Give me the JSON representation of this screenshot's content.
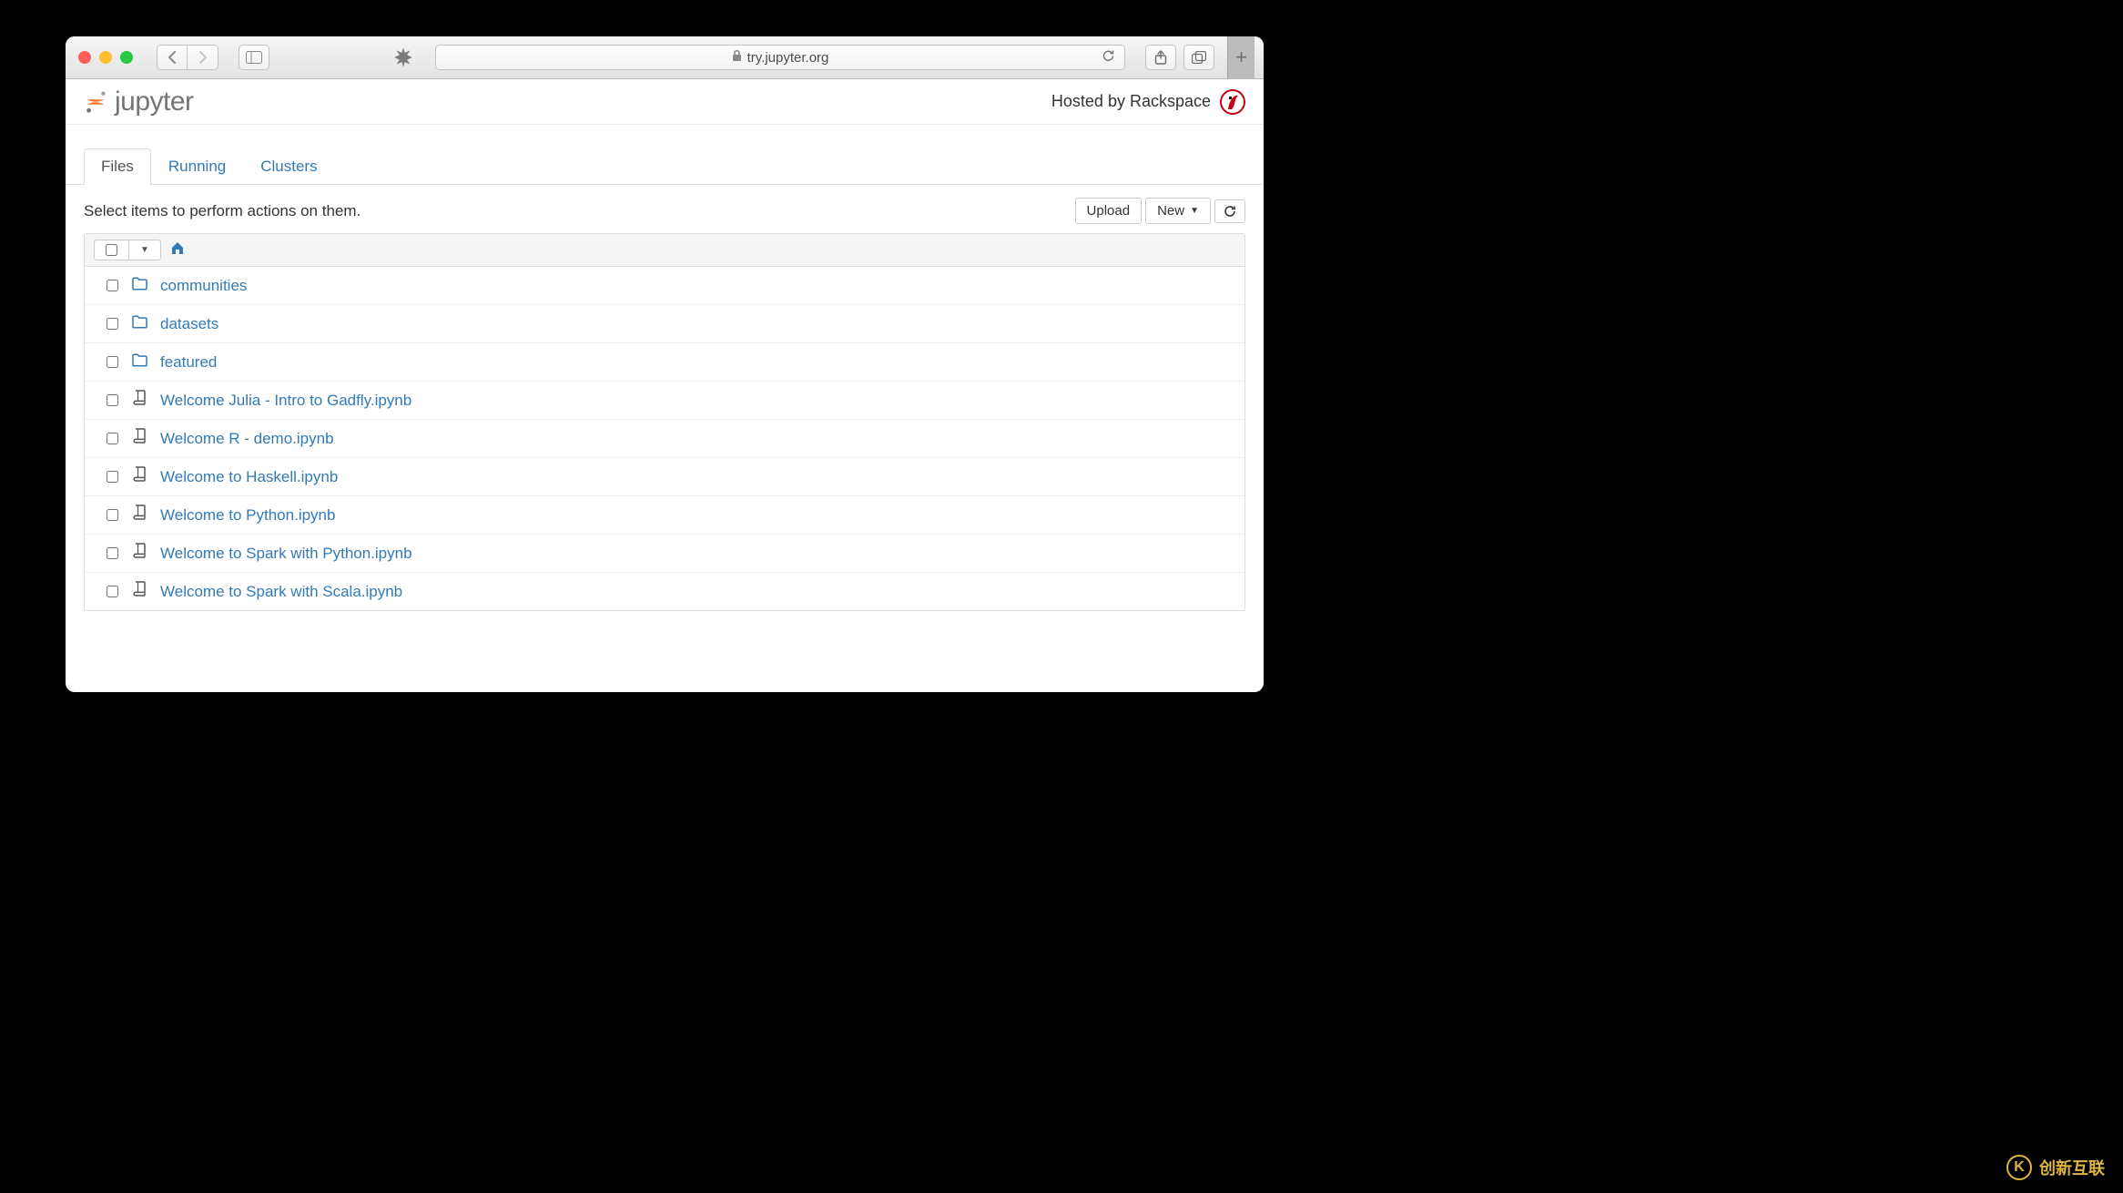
{
  "browser": {
    "url": "try.jupyter.org"
  },
  "header": {
    "logo_text": "jupyter",
    "hosted_label": "Hosted by Rackspace"
  },
  "tabs": [
    {
      "label": "Files",
      "active": true
    },
    {
      "label": "Running",
      "active": false
    },
    {
      "label": "Clusters",
      "active": false
    }
  ],
  "toolbar": {
    "prompt": "Select items to perform actions on them.",
    "upload_label": "Upload",
    "new_label": "New"
  },
  "items": [
    {
      "type": "folder",
      "name": "communities"
    },
    {
      "type": "folder",
      "name": "datasets"
    },
    {
      "type": "folder",
      "name": "featured"
    },
    {
      "type": "notebook",
      "name": "Welcome Julia - Intro to Gadfly.ipynb"
    },
    {
      "type": "notebook",
      "name": "Welcome R - demo.ipynb"
    },
    {
      "type": "notebook",
      "name": "Welcome to Haskell.ipynb"
    },
    {
      "type": "notebook",
      "name": "Welcome to Python.ipynb"
    },
    {
      "type": "notebook",
      "name": "Welcome to Spark with Python.ipynb"
    },
    {
      "type": "notebook",
      "name": "Welcome to Spark with Scala.ipynb"
    }
  ],
  "watermark": {
    "text": "创新互联"
  }
}
